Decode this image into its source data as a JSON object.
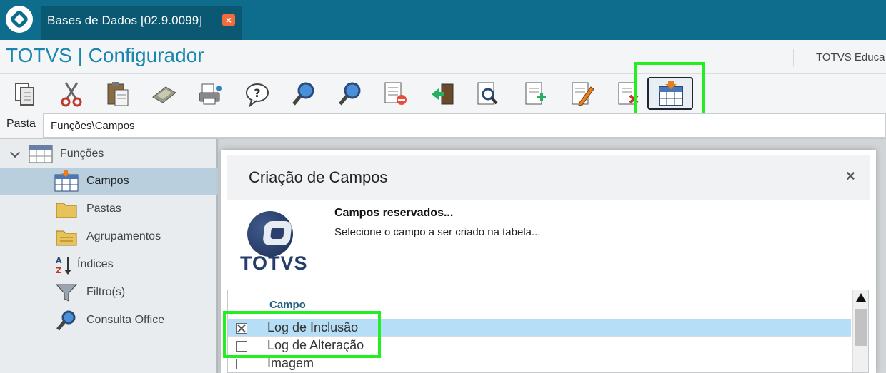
{
  "tab": {
    "title": "Bases de Dados [02.9.0099]"
  },
  "header": {
    "app_title": "TOTVS | Configurador",
    "company": "TOTVS Educa"
  },
  "toolbar": {
    "buttons": [
      "copy-icon",
      "cut-icon",
      "paste-icon",
      "calculator-icon",
      "print-icon",
      "help-icon",
      "search-icon",
      "search-next-icon",
      "close-list-icon",
      "exit-icon",
      "preview-icon",
      "new-document-icon",
      "edit-document-icon",
      "delete-document-icon",
      "create-field-icon"
    ],
    "active_button": "create-field-icon"
  },
  "path": {
    "label": "Pasta",
    "value": "Funções\\Campos"
  },
  "tree": {
    "root": {
      "label": "Funções",
      "icon": "table-icon",
      "expanded": true
    },
    "items": [
      {
        "label": "Campos",
        "icon": "table-field-icon",
        "selected": true
      },
      {
        "label": "Pastas",
        "icon": "folder-icon"
      },
      {
        "label": "Agrupamentos",
        "icon": "folder-group-icon"
      },
      {
        "label": "Índices",
        "icon": "sort-az-icon"
      },
      {
        "label": "Filtro(s)",
        "icon": "filter-icon"
      },
      {
        "label": "Consulta Office",
        "icon": "magnifier-icon"
      }
    ]
  },
  "modal": {
    "title": "Criação de Campos",
    "close": "×",
    "logo_text": "TOTVS",
    "info_title": "Campos reservados...",
    "info_subtitle": "Selecione o campo a ser criado na tabela...",
    "grid": {
      "column": "Campo",
      "rows": [
        {
          "label": "Log de Inclusão",
          "checked": true,
          "selected": true
        },
        {
          "label": "Log de Alteração",
          "checked": false,
          "selected": false
        },
        {
          "label": "Imagem",
          "checked": false,
          "selected": false
        }
      ]
    }
  },
  "colors": {
    "brand": "#0e6d8c",
    "title": "#1a86ae",
    "highlight": "#22ee22",
    "selection": "#b7def7"
  }
}
